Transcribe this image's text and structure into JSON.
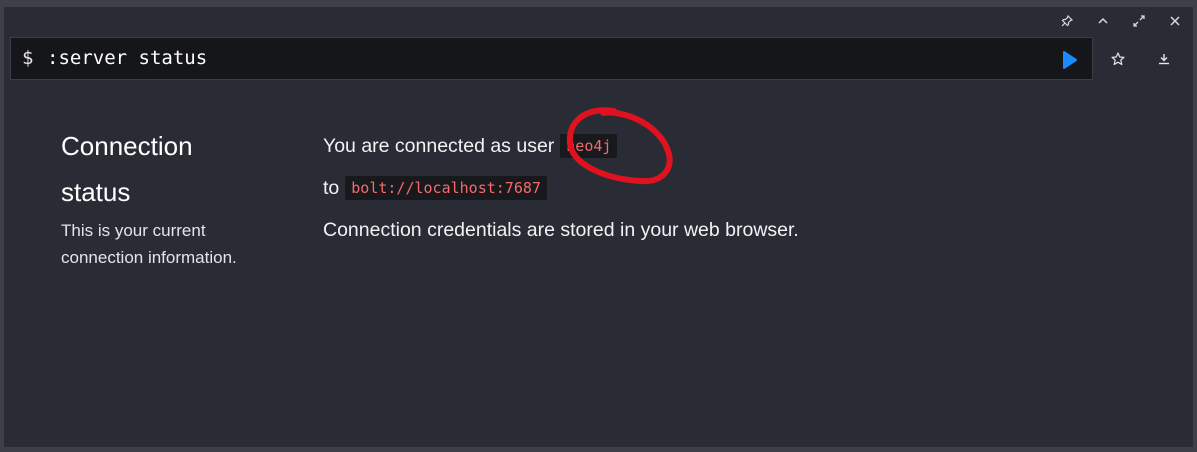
{
  "toolbar": {
    "pin_icon": "pin-icon",
    "collapse_icon": "chevron-up-icon",
    "expand_icon": "expand-icon",
    "close_icon": "close-icon"
  },
  "editor": {
    "prompt": "$",
    "command": ":server status",
    "run_icon": "play-icon",
    "accent": "#1a8cff"
  },
  "side_actions": {
    "favorite_icon": "star-icon",
    "download_icon": "download-icon"
  },
  "left": {
    "title_line1": "Connection",
    "title_line2": "status",
    "description": "This is your current connection information."
  },
  "content": {
    "connected_prefix": "You are connected as user",
    "user": "neo4j",
    "to_label": "to",
    "address": "bolt://localhost:7687",
    "credentials_note": "Connection credentials are stored in your web browser."
  },
  "annotation_color": "#e0121f"
}
